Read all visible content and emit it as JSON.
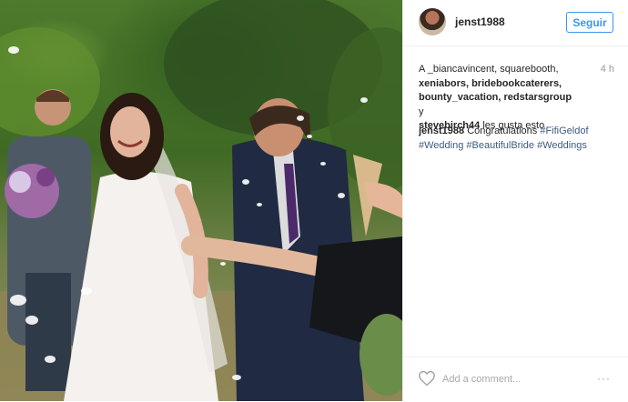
{
  "post": {
    "username": "jenst1988",
    "follow_label": "Seguir",
    "time_ago": "4 h",
    "likes": {
      "names_line1": "A _biancavincent, squarebooth,",
      "names_line2": "xeniabors, bridebookcaterers,",
      "names_line3": "bounty_vacation, redstarsgroup",
      "conj": "y",
      "names_line4": "stevebirch44",
      "suffix": "les gusta esto"
    },
    "caption": {
      "user": "jenst1988",
      "text": "Congratulations",
      "hashtags": [
        "#FifiGeldof",
        "#Wedding",
        "#BeautifulBride",
        "#Weddings"
      ]
    },
    "comment_placeholder": "Add a comment...",
    "more_icon": "···"
  },
  "icons": {
    "heart": "heart-icon",
    "more": "more-options-icon"
  },
  "colors": {
    "link": "#3897f0",
    "hashtag": "#3d5a80",
    "text": "#262626",
    "muted": "#999999"
  }
}
